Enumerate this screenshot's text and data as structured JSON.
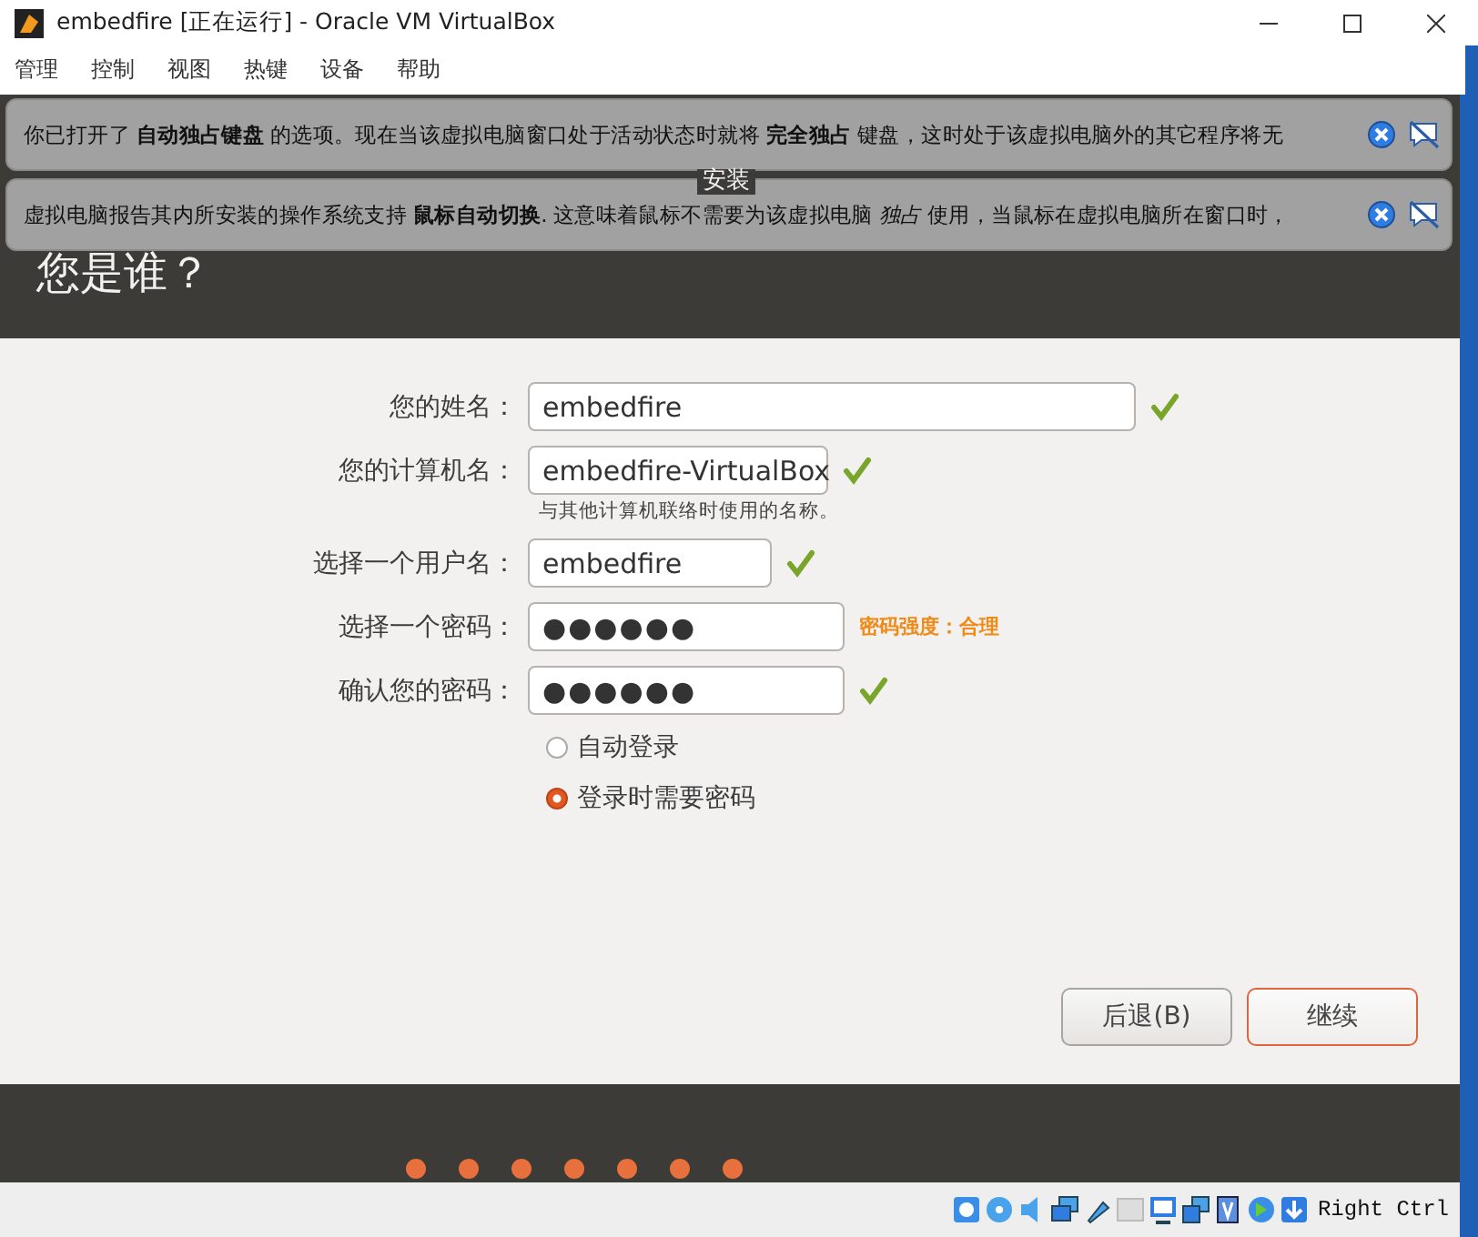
{
  "window": {
    "title": "embedfire [正在运行] - Oracle VM VirtualBox"
  },
  "menu": [
    "管理",
    "控制",
    "视图",
    "热键",
    "设备",
    "帮助"
  ],
  "notifications": [
    {
      "text": "你已打开了 **自动独占键盘** 的选项。现在当该虚拟电脑窗口处于活动状态时就将 **完全独占** 键盘，这时处于该虚拟电脑外的其它程序将无"
    },
    {
      "text": "虚拟电脑报告其内所安装的操作系统支持 **鼠标自动切换**. 这意味着鼠标不需要为该虚拟电脑 *独占* 使用，当鼠标在虚拟电脑所在窗口时，"
    }
  ],
  "installer": {
    "title": "安装",
    "heading": "您是谁？",
    "fields": [
      {
        "label": "您的姓名：",
        "value": "embedfire",
        "kind": "text",
        "valid": true
      },
      {
        "label": "您的计算机名：",
        "value": "embedfire-VirtualBox",
        "kind": "text",
        "valid": true,
        "hint": "与其他计算机联络时使用的名称。"
      },
      {
        "label": "选择一个用户名：",
        "value": "embedfire",
        "kind": "text",
        "valid": true
      },
      {
        "label": "选择一个密码：",
        "value": "●●●●●●",
        "kind": "password",
        "valid": false,
        "strength": "密码强度：合理"
      },
      {
        "label": "确认您的密码：",
        "value": "●●●●●●",
        "kind": "password",
        "valid": true
      }
    ],
    "login_options": [
      {
        "label": "自动登录",
        "selected": false
      },
      {
        "label": "登录时需要密码",
        "selected": true
      }
    ],
    "buttons": [
      {
        "label": "后退(B)",
        "kind": "secondary"
      },
      {
        "label": "继续",
        "kind": "primary"
      }
    ]
  },
  "status_bar": {
    "host_key": "Right Ctrl"
  }
}
